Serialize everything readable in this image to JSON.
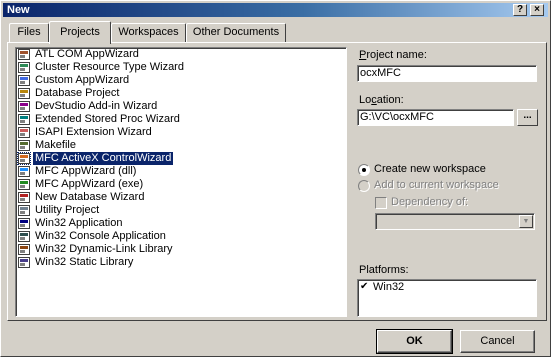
{
  "window": {
    "title": "New",
    "help_glyph": "?",
    "close_glyph": "×"
  },
  "tabs": [
    {
      "label": "Files",
      "active": false
    },
    {
      "label": "Projects",
      "active": true
    },
    {
      "label": "Workspaces",
      "active": false
    },
    {
      "label": "Other Documents",
      "active": false
    }
  ],
  "project_types": [
    {
      "label": "ATL COM AppWizard",
      "icon": "atl-com-icon",
      "selected": false
    },
    {
      "label": "Cluster Resource Type Wizard",
      "icon": "cluster-icon",
      "selected": false
    },
    {
      "label": "Custom AppWizard",
      "icon": "custom-wizard-icon",
      "selected": false
    },
    {
      "label": "Database Project",
      "icon": "database-icon",
      "selected": false
    },
    {
      "label": "DevStudio Add-in Wizard",
      "icon": "addin-icon",
      "selected": false
    },
    {
      "label": "Extended Stored Proc Wizard",
      "icon": "stored-proc-icon",
      "selected": false
    },
    {
      "label": "ISAPI Extension Wizard",
      "icon": "isapi-icon",
      "selected": false
    },
    {
      "label": "Makefile",
      "icon": "makefile-icon",
      "selected": false
    },
    {
      "label": "MFC ActiveX ControlWizard",
      "icon": "activex-icon",
      "selected": true
    },
    {
      "label": "MFC AppWizard (dll)",
      "icon": "mfc-dll-icon",
      "selected": false
    },
    {
      "label": "MFC AppWizard (exe)",
      "icon": "mfc-exe-icon",
      "selected": false
    },
    {
      "label": "New Database Wizard",
      "icon": "new-db-icon",
      "selected": false
    },
    {
      "label": "Utility Project",
      "icon": "utility-icon",
      "selected": false
    },
    {
      "label": "Win32 Application",
      "icon": "win32-app-icon",
      "selected": false
    },
    {
      "label": "Win32 Console Application",
      "icon": "console-icon",
      "selected": false
    },
    {
      "label": "Win32 Dynamic-Link Library",
      "icon": "dll-icon",
      "selected": false
    },
    {
      "label": "Win32 Static Library",
      "icon": "lib-icon",
      "selected": false
    }
  ],
  "project_name": {
    "label": "Project name:",
    "value": "ocxMFC"
  },
  "location": {
    "label": "Location:",
    "value": "G:\\VC\\ocxMFC",
    "browse_label": "..."
  },
  "workspace": {
    "create_label": "Create new workspace",
    "add_label": "Add to current workspace",
    "dependency_label": "Dependency of:",
    "dependency_value": ""
  },
  "platforms": {
    "label": "Platforms:",
    "items": [
      {
        "label": "Win32",
        "checked": true
      }
    ]
  },
  "buttons": {
    "ok": "OK",
    "cancel": "Cancel"
  }
}
